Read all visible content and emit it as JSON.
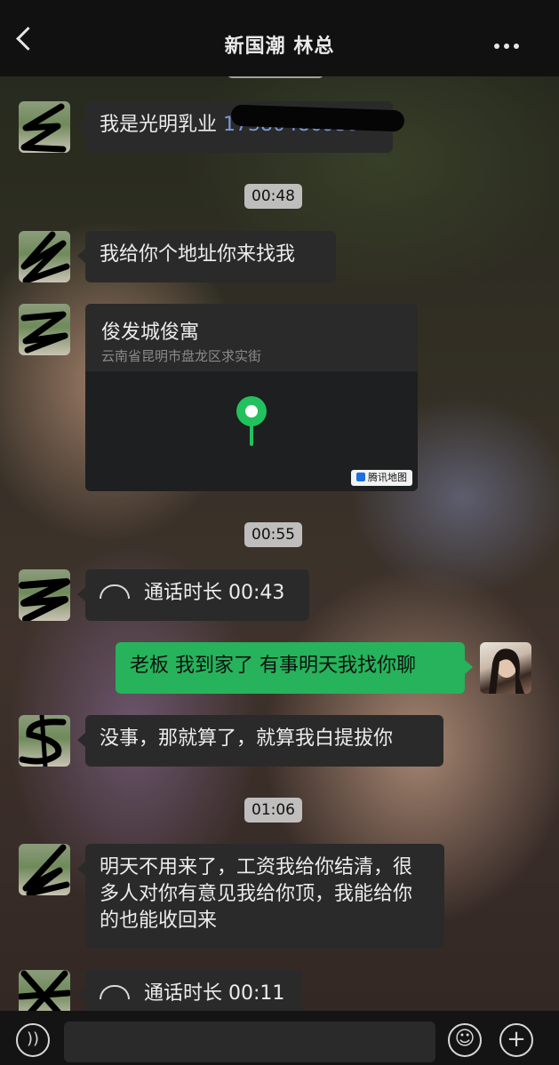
{
  "header": {
    "title": "新国潮 林总"
  },
  "messages": {
    "m1": {
      "text": "我是光明乳业 ",
      "phone": "17380480939"
    },
    "ts1": "00:48",
    "m2": "我给你个地址你来找我",
    "location": {
      "name": "俊发城俊寓",
      "address": "云南省昆明市盘龙区求实街",
      "provider": "腾讯地图"
    },
    "ts2": "00:55",
    "call1": "通话时长 00:43",
    "m3": "老板 我到家了 有事明天我找你聊",
    "m4": "没事，那就算了，就算我白提拔你",
    "ts3": "01:06",
    "m5": "明天不用来了，工资我给你结清，很多人对你有意见我给你顶，我能给你的也能收回来",
    "call2": "通话时长 00:11"
  },
  "colors": {
    "self_bubble": "#26b35b",
    "other_bubble": "#2a2a2a",
    "accent": "#22c15e"
  }
}
